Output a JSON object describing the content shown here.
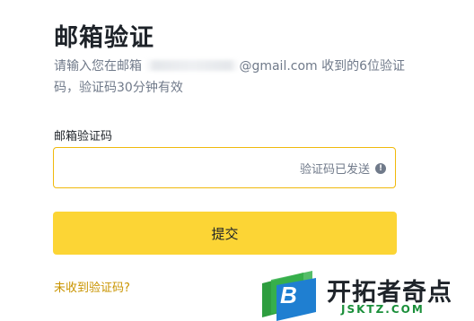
{
  "page": {
    "title": "邮箱验证",
    "description_prefix": "请输入您在邮箱 ",
    "description_suffix": "@gmail.com 收到的6位验证码，验证码30分钟有效"
  },
  "form": {
    "field_label": "邮箱验证码",
    "code_value": "",
    "status_text": "验证码已发送",
    "status_icon": "info-icon",
    "submit_label": "提交",
    "help_link": "未收到验证码?"
  },
  "watermark": {
    "logo_letter": "B",
    "brand_text": "开拓者奇点",
    "domain_text": "JSKTZ.COM"
  },
  "colors": {
    "accent": "#fcd535",
    "input_border": "#f0b90b",
    "link": "#c99400",
    "muted_text": "#707a8a"
  }
}
